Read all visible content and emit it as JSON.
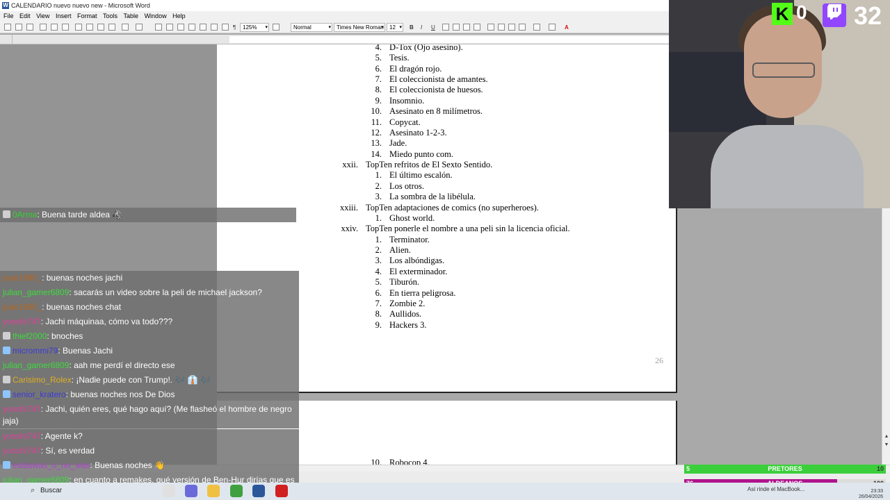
{
  "window": {
    "title": "CALENDARIO nuevo nuevo new - Microsoft Word",
    "menu": [
      "File",
      "Edit",
      "View",
      "Insert",
      "Format",
      "Tools",
      "Table",
      "Window",
      "Help"
    ]
  },
  "toolbar": {
    "zoom": "125%",
    "style": "Normal",
    "font": "Times New Roman",
    "size": "12",
    "bold": "B",
    "italic": "I",
    "underline": "U"
  },
  "document": {
    "page1": [
      {
        "num": "4.",
        "text": "D-Tox (Ojo asesino)."
      },
      {
        "num": "5.",
        "text": "Tesis."
      },
      {
        "num": "6.",
        "text": "El dragón rojo."
      },
      {
        "num": "7.",
        "text": "El coleccionista de amantes."
      },
      {
        "num": "8.",
        "text": "El coleccionista de huesos."
      },
      {
        "num": "9.",
        "text": "Insomnio."
      },
      {
        "num": "10.",
        "text": "Asesinato en 8 milímetros."
      },
      {
        "num": "11.",
        "text": "Copycat."
      },
      {
        "num": "12.",
        "text": "Asesinato 1-2-3."
      },
      {
        "num": "13.",
        "text": "Jade."
      },
      {
        "num": "14.",
        "text": "Miedo punto com."
      },
      {
        "num": "xxii.",
        "text": "TopTen refritos de El Sexto Sentido.",
        "heading": true
      },
      {
        "num": "1.",
        "text": "El último escalón."
      },
      {
        "num": "2.",
        "text": "Los otros."
      },
      {
        "num": "3.",
        "text": "La sombra de la libélula."
      },
      {
        "num": "xxiii.",
        "text": "TopTen adaptaciones de comics (no superheroes).",
        "heading": true
      },
      {
        "num": "1.",
        "text": "Ghost world."
      },
      {
        "num": "xxiv.",
        "text": "TopTen ponerle el nombre a una peli sin la licencia oficial.",
        "heading": true
      },
      {
        "num": "1.",
        "text": "Terminator."
      },
      {
        "num": "2.",
        "text": "Alien."
      },
      {
        "num": "3.",
        "text": "Los albóndigas."
      },
      {
        "num": "4.",
        "text": "El exterminador."
      },
      {
        "num": "5.",
        "text": "Tiburón."
      },
      {
        "num": "6.",
        "text": "En tierra peligrosa."
      },
      {
        "num": "7.",
        "text": "Zombie 2."
      },
      {
        "num": "8.",
        "text": "Aullidos."
      },
      {
        "num": "9.",
        "text": "Hackers 3."
      }
    ],
    "page_number": "26",
    "page2": [
      {
        "num": "10.",
        "text": "Robocop 4."
      }
    ]
  },
  "chat": [
    {
      "user": "0Arma",
      "color": "#31d431",
      "msg": ": Buena tarde aldea 🦓"
    },
    {
      "user": "juan1985_",
      "color": "#b5651d",
      "msg": ": buenas noches jachi"
    },
    {
      "user": "julian_gamer6809",
      "color": "#3ddc3d",
      "msg": ": sacarás un video sobre la peli de michael jackson?"
    },
    {
      "user": "juan1985_",
      "color": "#b5651d",
      "msg": ": buenas noches chat"
    },
    {
      "user": "yonshi747",
      "color": "#e0409a",
      "msg": ": Jachi máquinaa, cómo va todo???"
    },
    {
      "user": "thief2000",
      "color": "#3ddc3d",
      "msg": ": bnoches"
    },
    {
      "user": "micrommi79",
      "color": "#3b3bd6",
      "msg": ": Buenas Jachi"
    },
    {
      "user": "julian_gamer6809",
      "color": "#3ddc3d",
      "msg": ": aah me perdí el directo ese"
    },
    {
      "user": "Carisimo_Rolex",
      "color": "#e0b020",
      "msg": ": ¡Nadie puede con Trump!. 🎶 👔 🎶"
    },
    {
      "user": "senior_kratero",
      "color": "#3b3bd6",
      "msg": ": buenas noches nos De Dios"
    },
    {
      "user": "yonshi747",
      "color": "#e0409a",
      "msg": ": Jachi, quién eres, qué hago aquí? (Me flasheó el hombre de negro jaja)"
    },
    {
      "user": "yonshi747",
      "color": "#e0409a",
      "msg": ": Agente k?"
    },
    {
      "user": "yonshi747",
      "color": "#e0409a",
      "msg": ": Sí, es verdad"
    },
    {
      "user": "estaswas_o_no_was",
      "color": "#b040d0",
      "msg": ": Buenas noches 👋"
    },
    {
      "user": "julian_gamer6809",
      "color": "#3ddc3d",
      "msg": ": en cuanto a remakes, qué versión de Ben-Hur dirías que es la mejor?"
    }
  ],
  "stream": {
    "kick_icon": "K",
    "kick_viewers": "0",
    "twitch_icon": "twitch-glyph",
    "twitch_viewers": "32"
  },
  "teams": [
    {
      "name": "PRETORES",
      "score": "5",
      "right": "10",
      "color": "#3ccf3c",
      "fill_fraction": 0.02
    },
    {
      "name": "ALDEANOS",
      "score": "76",
      "right": "100",
      "color": "#b0148c",
      "fill_fraction": 0.76
    }
  ],
  "taskbar": {
    "search": "Buscar",
    "notification": "Así rinde el MacBook...",
    "time": "23:33",
    "date": "26/04/2026"
  }
}
